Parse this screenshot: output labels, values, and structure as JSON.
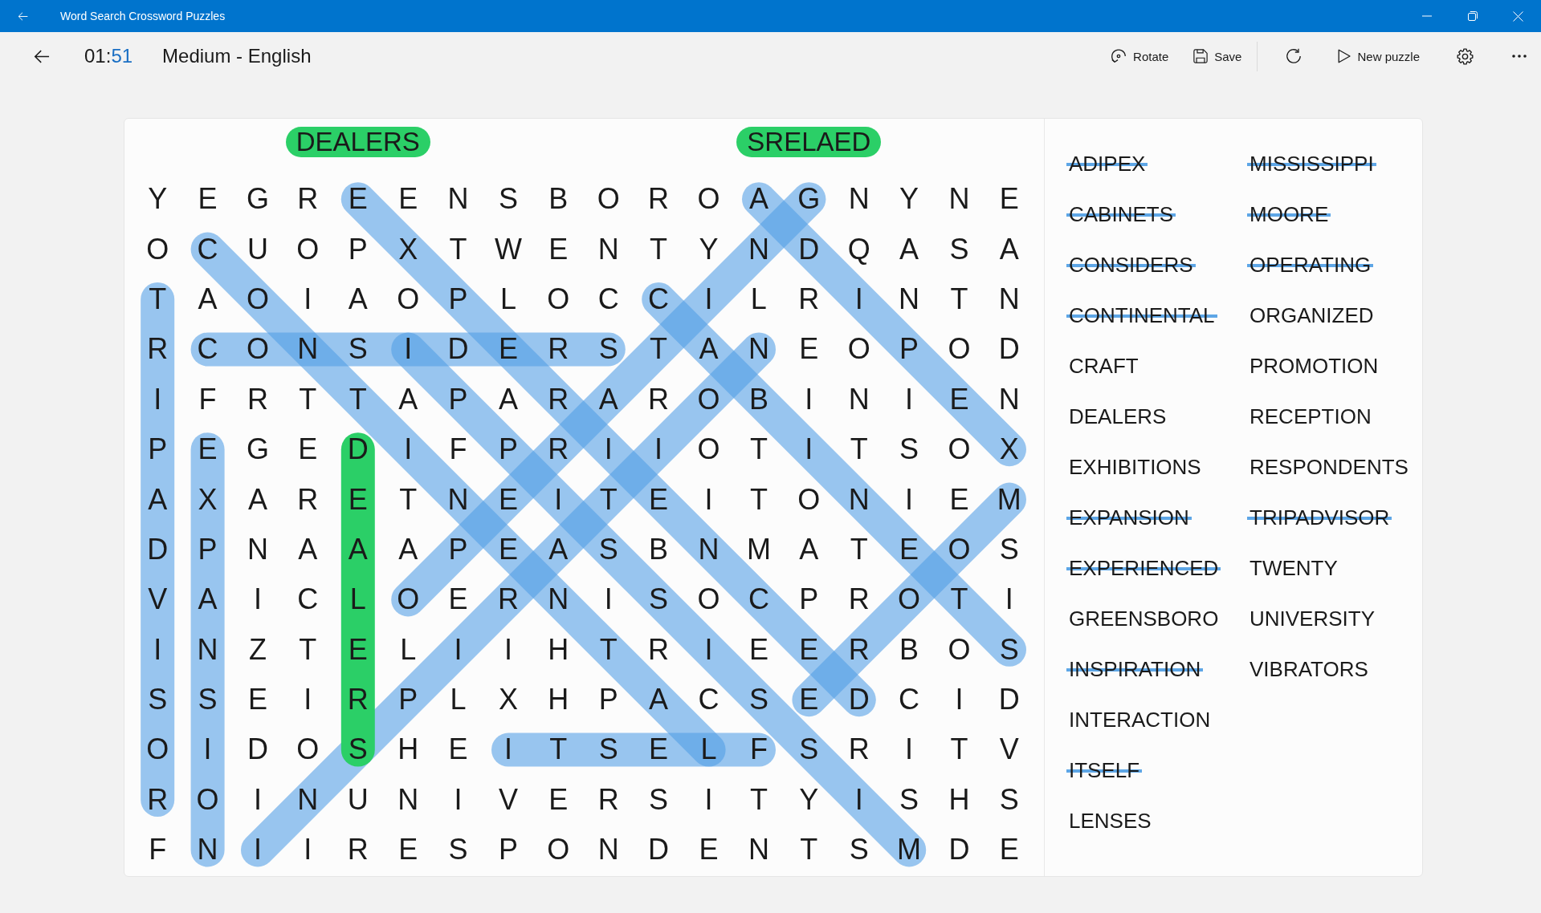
{
  "title_bar": {
    "title": "Word Search Crossword Puzzles"
  },
  "toolbar": {
    "timer": {
      "minutes": "01",
      "separator": ":",
      "seconds": "51"
    },
    "title": "Medium - English",
    "actions": [
      {
        "kind": "rotate",
        "label": "Rotate"
      },
      {
        "kind": "save",
        "label": "Save"
      },
      {
        "kind": "separator"
      },
      {
        "kind": "refresh"
      },
      {
        "kind": "new_puzzle",
        "label": "New puzzle"
      },
      {
        "kind": "settings"
      },
      {
        "kind": "more"
      }
    ]
  },
  "puzzle": {
    "found_word": {
      "forward": "DEALERS",
      "reversed": "SRELAED"
    },
    "grid": [
      [
        "Y",
        "E",
        "G",
        "R",
        "E",
        "E",
        "N",
        "S",
        "B",
        "O",
        "R",
        "O",
        "A",
        "G",
        "N",
        "Y",
        "N",
        "E"
      ],
      [
        "O",
        "C",
        "U",
        "O",
        "P",
        "X",
        "T",
        "W",
        "E",
        "N",
        "T",
        "Y",
        "N",
        "D",
        "Q",
        "A",
        "S",
        "A"
      ],
      [
        "T",
        "A",
        "O",
        "I",
        "A",
        "O",
        "P",
        "L",
        "O",
        "C",
        "C",
        "I",
        "L",
        "R",
        "I",
        "N",
        "T",
        "N"
      ],
      [
        "R",
        "C",
        "O",
        "N",
        "S",
        "I",
        "D",
        "E",
        "R",
        "S",
        "T",
        "A",
        "N",
        "E",
        "O",
        "P",
        "O",
        "D"
      ],
      [
        "I",
        "F",
        "R",
        "T",
        "T",
        "A",
        "P",
        "A",
        "R",
        "A",
        "R",
        "O",
        "B",
        "I",
        "N",
        "I",
        "E",
        "N"
      ],
      [
        "P",
        "E",
        "G",
        "E",
        "D",
        "I",
        "F",
        "P",
        "R",
        "I",
        "I",
        "O",
        "T",
        "I",
        "T",
        "S",
        "O",
        "X"
      ],
      [
        "A",
        "X",
        "A",
        "R",
        "E",
        "T",
        "N",
        "E",
        "I",
        "T",
        "E",
        "I",
        "T",
        "O",
        "N",
        "I",
        "E",
        "M"
      ],
      [
        "D",
        "P",
        "N",
        "A",
        "A",
        "A",
        "P",
        "E",
        "A",
        "S",
        "B",
        "N",
        "M",
        "A",
        "T",
        "E",
        "O",
        "S"
      ],
      [
        "V",
        "A",
        "I",
        "C",
        "L",
        "O",
        "E",
        "R",
        "N",
        "I",
        "S",
        "O",
        "C",
        "P",
        "R",
        "O",
        "T",
        "I"
      ],
      [
        "I",
        "N",
        "Z",
        "T",
        "E",
        "L",
        "I",
        "I",
        "H",
        "T",
        "R",
        "I",
        "E",
        "E",
        "R",
        "B",
        "O",
        "S"
      ],
      [
        "S",
        "S",
        "E",
        "I",
        "R",
        "P",
        "L",
        "X",
        "H",
        "P",
        "A",
        "C",
        "S",
        "E",
        "D",
        "C",
        "I",
        "D"
      ],
      [
        "O",
        "I",
        "D",
        "O",
        "S",
        "H",
        "E",
        "I",
        "T",
        "S",
        "E",
        "L",
        "F",
        "S",
        "R",
        "I",
        "T",
        "V"
      ],
      [
        "R",
        "O",
        "I",
        "N",
        "U",
        "N",
        "I",
        "V",
        "E",
        "R",
        "S",
        "I",
        "T",
        "Y",
        "I",
        "S",
        "H",
        "S"
      ],
      [
        "F",
        "N",
        "I",
        "I",
        "R",
        "E",
        "S",
        "P",
        "O",
        "N",
        "D",
        "E",
        "N",
        "T",
        "S",
        "M",
        "D",
        "E"
      ]
    ]
  },
  "word_columns": [
    [
      {
        "word": "ADIPEX",
        "crossed_out": true
      },
      {
        "word": "CABINETS",
        "crossed_out": true
      },
      {
        "word": "CONSIDERS",
        "crossed_out": true
      },
      {
        "word": "CONTINENTAL",
        "crossed_out": true
      },
      {
        "word": "CRAFT",
        "crossed_out": false
      },
      {
        "word": "DEALERS",
        "crossed_out": false
      },
      {
        "word": "EXHIBITIONS",
        "crossed_out": false
      },
      {
        "word": "EXPANSION",
        "crossed_out": true
      },
      {
        "word": "EXPERIENCED",
        "crossed_out": true
      },
      {
        "word": "GREENSBORO",
        "crossed_out": false
      },
      {
        "word": "INSPIRATION",
        "crossed_out": true
      },
      {
        "word": "INTERACTION",
        "crossed_out": false
      },
      {
        "word": "ITSELF",
        "crossed_out": true
      },
      {
        "word": "LENSES",
        "crossed_out": false
      }
    ],
    [
      {
        "word": "MISSISSIPPI",
        "crossed_out": true
      },
      {
        "word": "MOORE",
        "crossed_out": true
      },
      {
        "word": "OPERATING",
        "crossed_out": true
      },
      {
        "word": "ORGANIZED",
        "crossed_out": false
      },
      {
        "word": "PROMOTION",
        "crossed_out": false
      },
      {
        "word": "RECEPTION",
        "crossed_out": false
      },
      {
        "word": "RESPONDENTS",
        "crossed_out": false
      },
      {
        "word": "TRIPADVISOR",
        "crossed_out": true
      },
      {
        "word": "TWENTY",
        "crossed_out": false
      },
      {
        "word": "UNIVERSITY",
        "crossed_out": false
      },
      {
        "word": "VIBRATORS",
        "crossed_out": false
      }
    ]
  ]
}
